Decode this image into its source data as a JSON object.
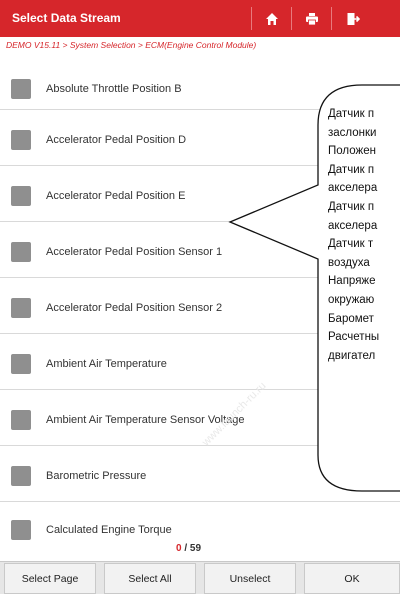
{
  "header": {
    "title": "Select Data Stream",
    "icons": [
      "home-icon",
      "print-icon",
      "exit-icon"
    ],
    "color": "#d6262b"
  },
  "breadcrumb": "DEMO V15.11 > System Selection > ECM(Engine Control Module)",
  "items": [
    {
      "label": "Absolute Throttle Position B",
      "checked": false
    },
    {
      "label": "Accelerator Pedal Position D",
      "checked": false
    },
    {
      "label": "Accelerator Pedal Position E",
      "checked": false
    },
    {
      "label": "Accelerator Pedal Position Sensor 1",
      "checked": false
    },
    {
      "label": "Accelerator Pedal Position Sensor 2",
      "checked": false
    },
    {
      "label": "Ambient Air Temperature",
      "checked": false
    },
    {
      "label": "Ambient Air Temperature Sensor Voltage",
      "checked": false
    },
    {
      "label": "Barometric Pressure",
      "checked": false
    },
    {
      "label": "Calculated Engine Torque",
      "checked": false
    }
  ],
  "counter": {
    "selected": "0",
    "total": "/ 59"
  },
  "footer": {
    "select_page": "Select Page",
    "select_all": "Select All",
    "unselect": "Unselect",
    "ok": "OK"
  },
  "callout_lines": [
    "Датчик п",
    "заслонки",
    "Положен",
    "Датчик п",
    "акселера",
    "Датчик п",
    "акселера",
    "Датчик т",
    "воздуха",
    "Напряже",
    "окружаю",
    "Баромет",
    "Расчетны",
    "двигател"
  ],
  "watermark": "www.launch-ru.ru"
}
